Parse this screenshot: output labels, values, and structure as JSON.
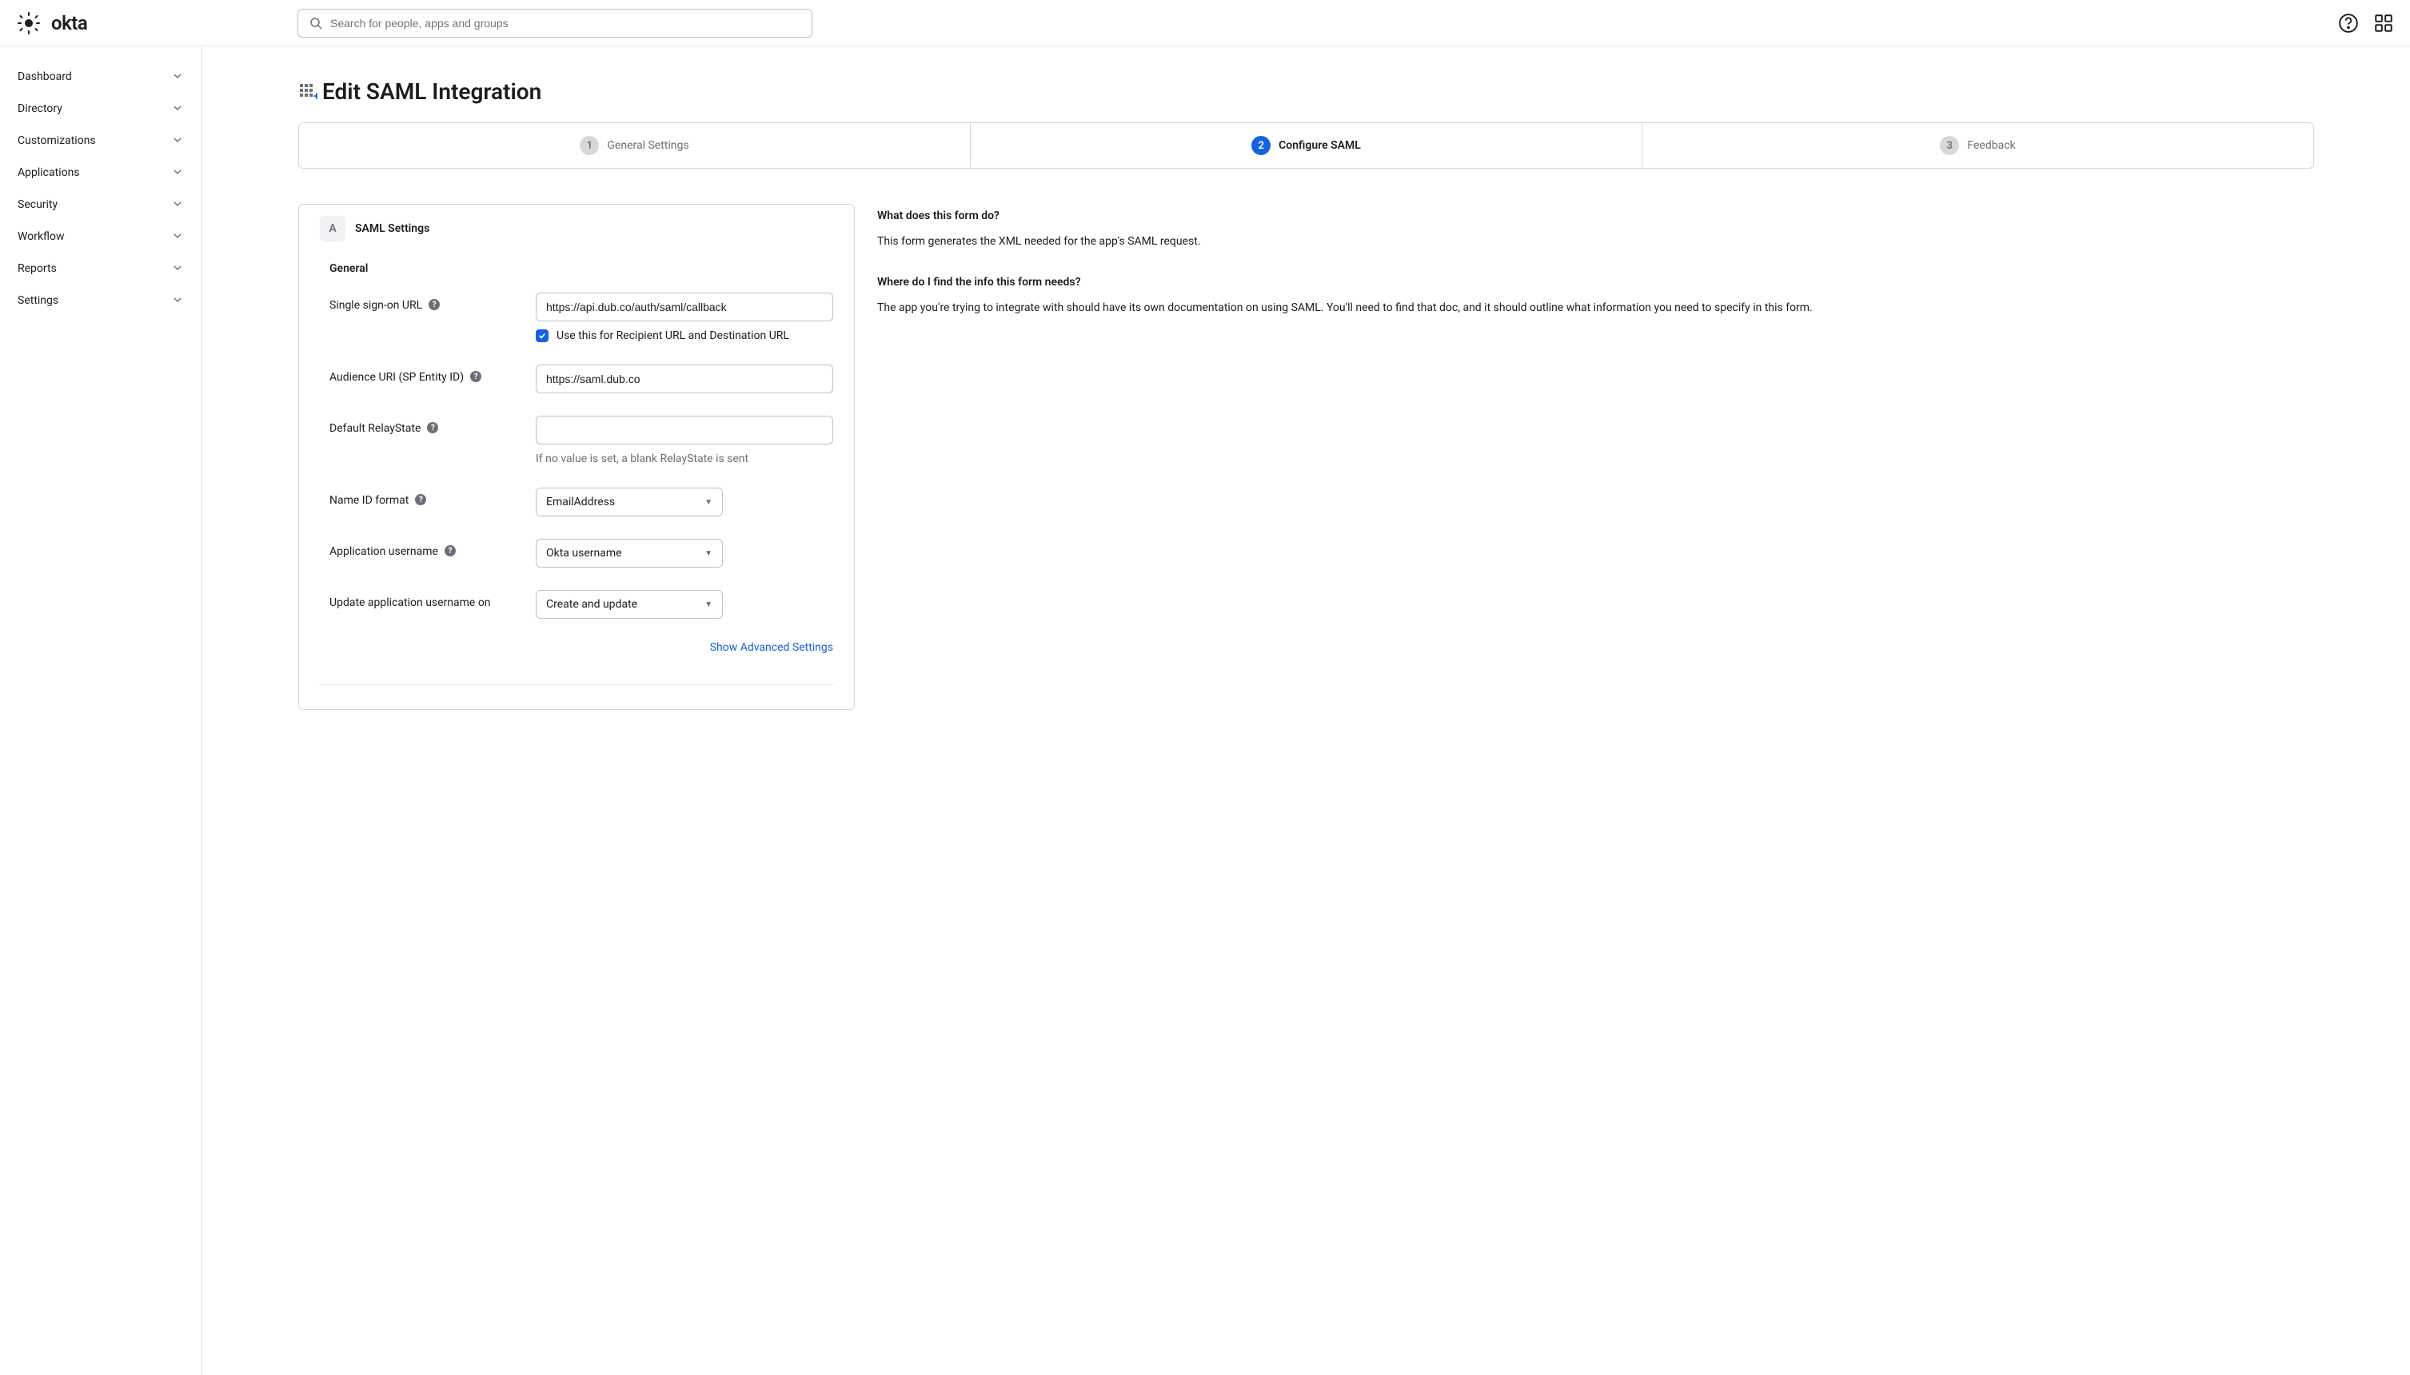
{
  "header": {
    "logo_text": "okta",
    "search_placeholder": "Search for people, apps and groups"
  },
  "sidebar": {
    "items": [
      {
        "label": "Dashboard"
      },
      {
        "label": "Directory"
      },
      {
        "label": "Customizations"
      },
      {
        "label": "Applications"
      },
      {
        "label": "Security"
      },
      {
        "label": "Workflow"
      },
      {
        "label": "Reports"
      },
      {
        "label": "Settings"
      }
    ]
  },
  "page": {
    "title": "Edit SAML Integration"
  },
  "stepper": {
    "steps": [
      {
        "num": "1",
        "label": "General Settings"
      },
      {
        "num": "2",
        "label": "Configure SAML"
      },
      {
        "num": "3",
        "label": "Feedback"
      }
    ]
  },
  "card": {
    "badge": "A",
    "title": "SAML Settings",
    "section": "General"
  },
  "fields": {
    "sso_url_label": "Single sign-on URL",
    "sso_url_value": "https://api.dub.co/auth/saml/callback",
    "sso_checkbox_label": "Use this for Recipient URL and Destination URL",
    "audience_label": "Audience URI (SP Entity ID)",
    "audience_value": "https://saml.dub.co",
    "relaystate_label": "Default RelayState",
    "relaystate_value": "",
    "relaystate_hint": "If no value is set, a blank RelayState is sent",
    "nameid_label": "Name ID format",
    "nameid_value": "EmailAddress",
    "app_username_label": "Application username",
    "app_username_value": "Okta username",
    "update_on_label": "Update application username on",
    "update_on_value": "Create and update",
    "advanced_link": "Show Advanced Settings"
  },
  "help": {
    "q1": "What does this form do?",
    "a1": "This form generates the XML needed for the app's SAML request.",
    "q2": "Where do I find the info this form needs?",
    "a2": "The app you're trying to integrate with should have its own documentation on using SAML. You'll need to find that doc, and it should outline what information you need to specify in this form."
  }
}
